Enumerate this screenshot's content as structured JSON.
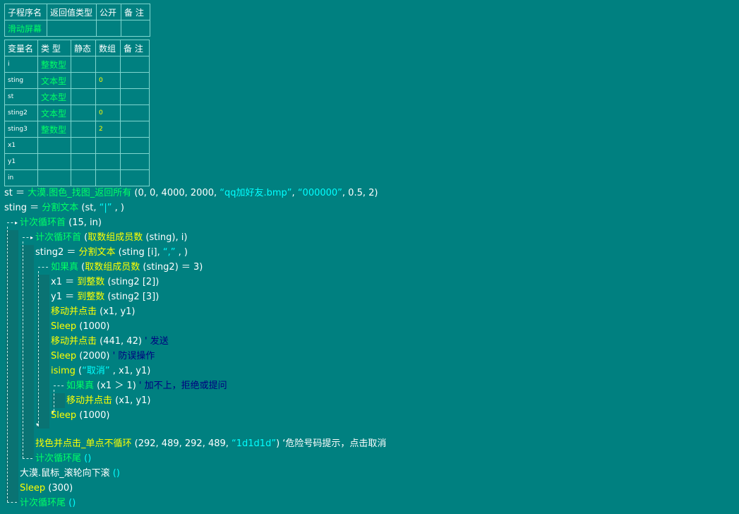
{
  "subroutine_table": {
    "headers": [
      "子程序名",
      "返回值类型",
      "公开",
      "备 注"
    ],
    "row": [
      "滑动屏幕",
      "",
      "",
      ""
    ]
  },
  "variable_table": {
    "headers": [
      "变量名",
      "类 型",
      "静态",
      "数组",
      "备 注"
    ],
    "rows": [
      {
        "name": "i",
        "type": "整数型",
        "static": "",
        "array": "",
        "note": ""
      },
      {
        "name": "sting",
        "type": "文本型",
        "static": "",
        "array": "0",
        "note": ""
      },
      {
        "name": "st",
        "type": "文本型",
        "static": "",
        "array": "",
        "note": ""
      },
      {
        "name": "sting2",
        "type": "文本型",
        "static": "",
        "array": "0",
        "note": ""
      },
      {
        "name": "sting3",
        "type": "整数型",
        "static": "",
        "array": "2",
        "note": ""
      },
      {
        "name": "x1",
        "type": "",
        "static": "",
        "array": "",
        "note": ""
      },
      {
        "name": "y1",
        "type": "",
        "static": "",
        "array": "",
        "note": ""
      },
      {
        "name": "in",
        "type": "",
        "static": "",
        "array": "",
        "note": ""
      }
    ]
  },
  "code": {
    "l1": {
      "a": "st ＝ ",
      "b": "大漠.图色_找图_返回所有",
      "c": " (0, 0, 4000, 2000, ",
      "d": "“qq加好友.bmp”",
      "e": ", ",
      "f": "“000000”",
      "g": ", 0.5, 2)"
    },
    "l2": {
      "a": "sting ＝ ",
      "b": "分割文本",
      "c": " (st, ",
      "d": "“|”",
      "e": " , )"
    },
    "l3": {
      "a": "计次循环首",
      "b": " (15, in)"
    },
    "l4": {
      "a": "计次循环首",
      "b": " (",
      "c": "取数组成员数",
      "d": " (sting), i)"
    },
    "l5": {
      "a": "sting2 ＝ ",
      "b": "分割文本",
      "c": " (sting [i], ",
      "d": "“,”",
      "e": " , )"
    },
    "l6": {
      "a": "如果真",
      "b": " (",
      "c": "取数组成员数",
      "d": " (sting2) ＝ 3)"
    },
    "l7": {
      "a": "x1 ＝ ",
      "b": "到整数",
      "c": " (sting2 [2])"
    },
    "l8": {
      "a": "y1 ＝ ",
      "b": "到整数",
      "c": " (sting2 [3])"
    },
    "l9": {
      "a": "移动并点击",
      "b": " (x1, y1)"
    },
    "l10": {
      "a": "Sleep",
      "b": " (1000)"
    },
    "l11": {
      "a": "移动并点击",
      "b": " (441, 42)",
      "c": "  ' 发送"
    },
    "l12": {
      "a": "Sleep",
      "b": " (2000)",
      "c": "  ' 防误操作"
    },
    "l13": {
      "a": "isimg",
      "b": " (",
      "c": "“取消”",
      "d": " , x1, y1)"
    },
    "l14": {
      "a": "如果真",
      "b": " (x1 ＞ 1)",
      "c": "  ' 加不上，拒绝或提问"
    },
    "l15": {
      "a": "移动并点击",
      "b": " (x1, y1)"
    },
    "l16": {
      "a": "Sleep",
      "b": " (1000)"
    },
    "l17": {
      "a": "找色并点击_单点不循环",
      "b": " (292, 489, 292, 489, ",
      "c": "“1d1d1d”",
      "d": ")",
      "e": "  ‘危险号码提示，点击取消"
    },
    "l18": {
      "a": "计次循环尾",
      "b": " ()"
    },
    "l19": {
      "a": "大漠.鼠标_滚轮向下滚",
      "b": " ()"
    },
    "l20": {
      "a": "Sleep",
      "b": " (300)"
    },
    "l21": {
      "a": "计次循环尾",
      "b": " ()"
    }
  },
  "colors": {
    "background": "#008080",
    "command": "#00ff66",
    "function": "#ffff00",
    "string": "#00ffff",
    "comment": "#000080"
  }
}
